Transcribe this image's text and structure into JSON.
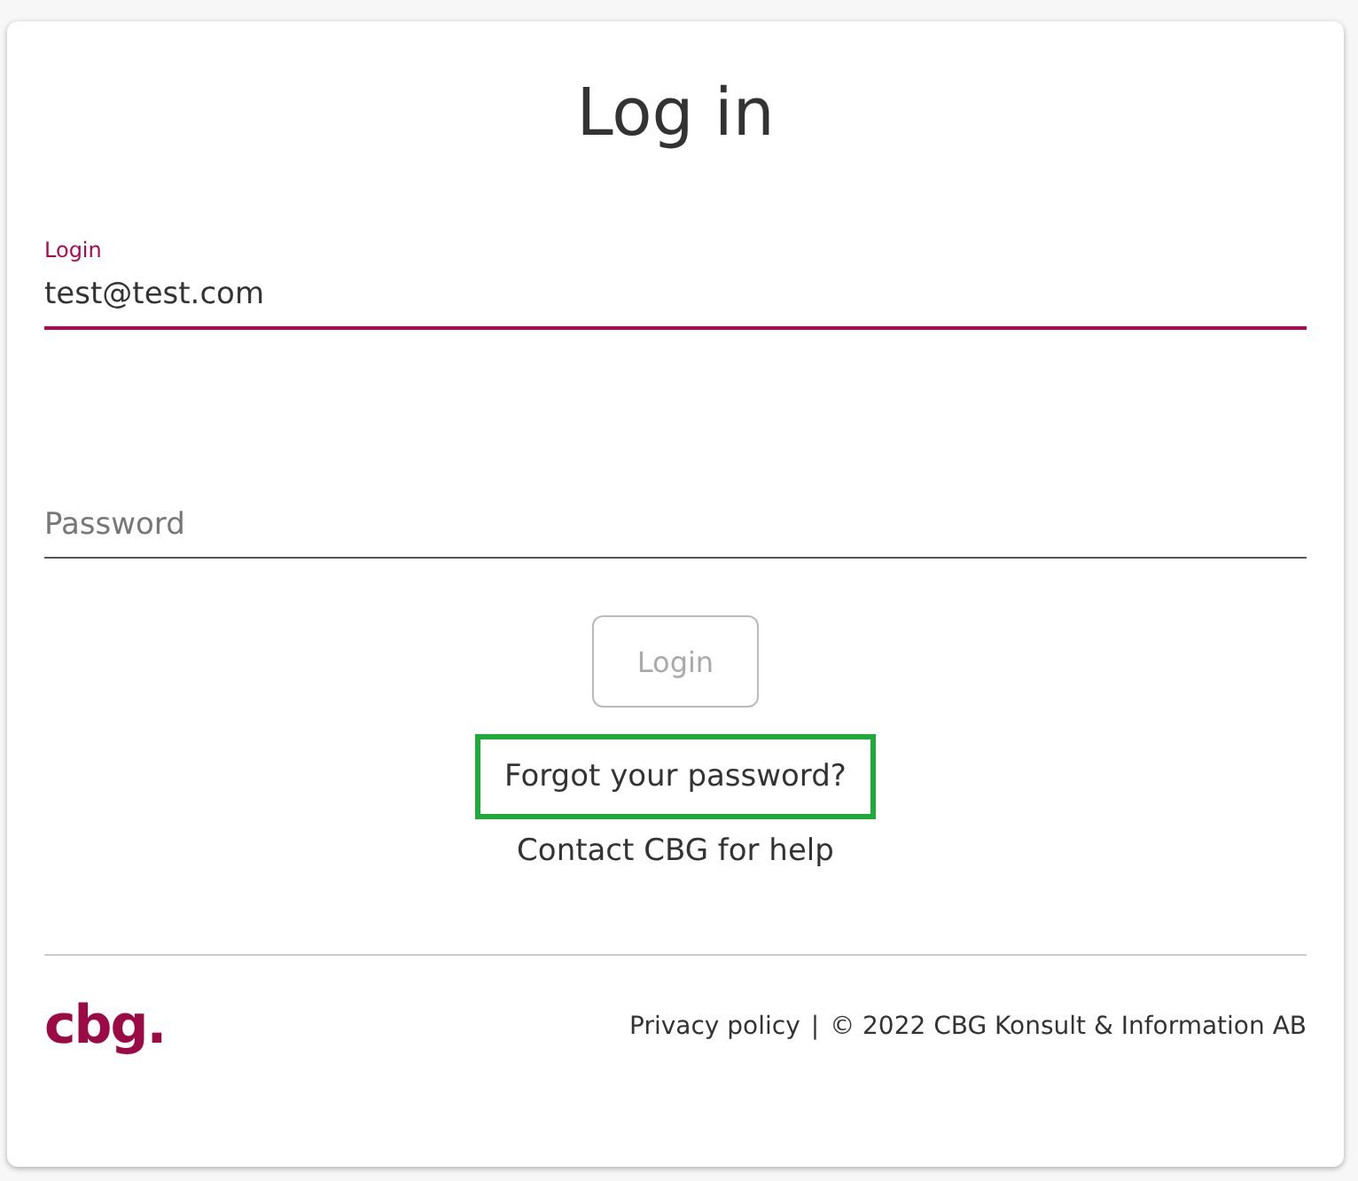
{
  "title": "Log in",
  "login_field": {
    "label": "Login",
    "value": "test@test.com",
    "focused": true
  },
  "password_field": {
    "placeholder": "Password",
    "focused": false
  },
  "login_button": {
    "label": "Login",
    "disabled": true
  },
  "forgot_link": {
    "label": "Forgot your password?",
    "highlighted": true
  },
  "contact_link": {
    "label": "Contact CBG for help"
  },
  "footer": {
    "logo": "cbg.",
    "privacy_link": "Privacy policy",
    "separator": "|",
    "copyright": "© 2022 CBG Konsult & Information AB"
  }
}
